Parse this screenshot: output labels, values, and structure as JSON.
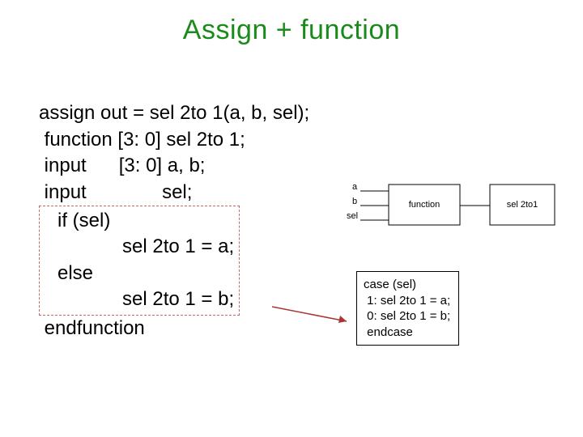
{
  "title": "Assign + function",
  "code": {
    "l1": "assign out = sel 2to 1(a, b, sel);",
    "l2": " function [3: 0] sel 2to 1;",
    "l3": " input      [3: 0] a, b;",
    "l4": " input              sel;",
    "l5": "   if (sel)",
    "l6": "               sel 2to 1 = a;",
    "l7": "   else",
    "l8": "               sel 2to 1 = b;",
    "l9": " endfunction"
  },
  "diagram": {
    "in_a": "a",
    "in_b": "b",
    "in_sel": "sel",
    "block": "function",
    "out": "sel 2to1"
  },
  "casebox": {
    "l1": "case (sel)",
    "l2": " 1: sel 2to 1 = a;",
    "l3": " 0: sel 2to 1 = b;",
    "l4": " endcase"
  }
}
